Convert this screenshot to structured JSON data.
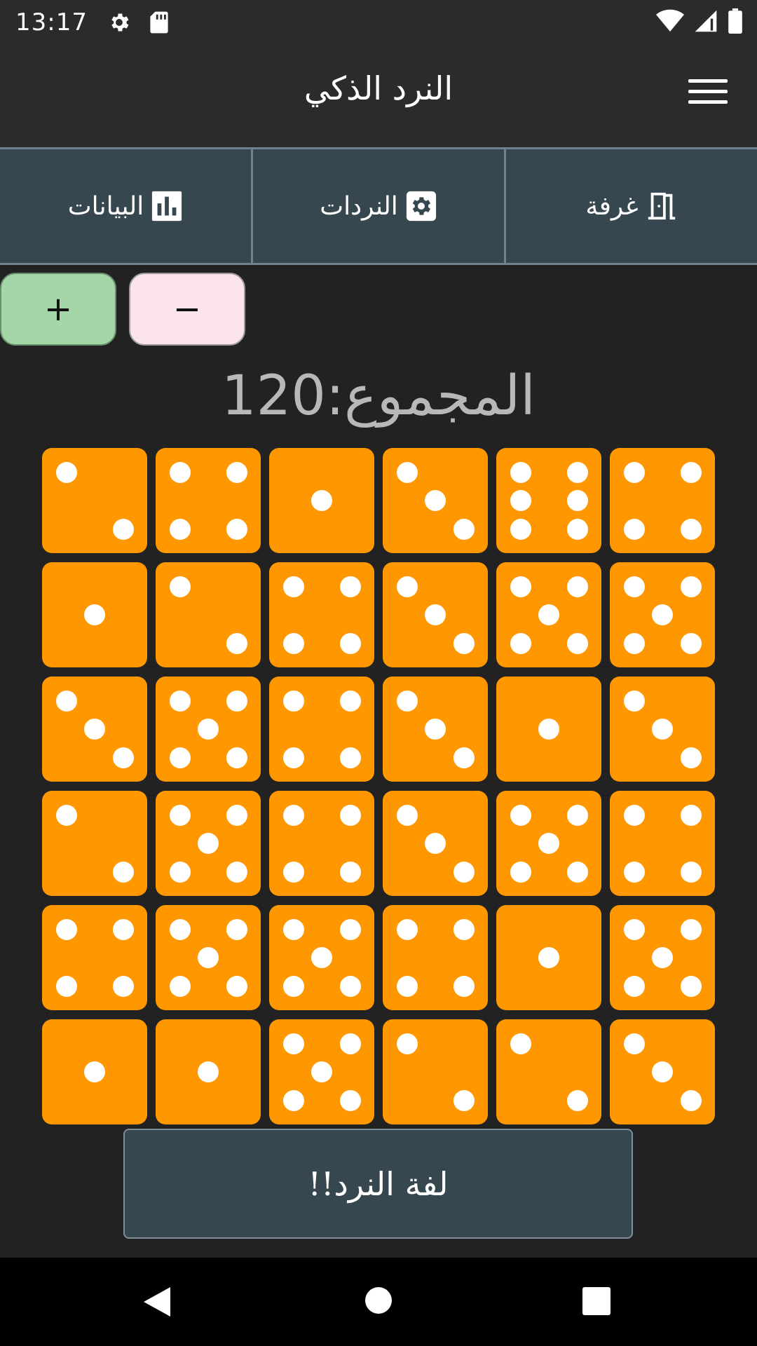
{
  "status_bar": {
    "time": "13:17",
    "left_icons": [
      "gear-icon",
      "sd-card-icon"
    ],
    "right_icons": [
      "wifi-icon",
      "signal-icon",
      "battery-icon"
    ]
  },
  "app_bar": {
    "title": "النرد الذكي",
    "menu_icon": "hamburger-menu-icon"
  },
  "tabs": [
    {
      "label": "البيانات",
      "icon": "bar-chart-icon"
    },
    {
      "label": "النردات",
      "icon": "settings-square-icon"
    },
    {
      "label": "غرفة",
      "icon": "door-icon"
    }
  ],
  "controls": {
    "plus_label": "+",
    "minus_label": "−"
  },
  "total": {
    "text": "المجموع:120"
  },
  "dice": [
    [
      2,
      4,
      1,
      3,
      6,
      4
    ],
    [
      1,
      2,
      4,
      3,
      5,
      5
    ],
    [
      3,
      5,
      4,
      3,
      1,
      3
    ],
    [
      2,
      5,
      4,
      3,
      5,
      4
    ],
    [
      4,
      5,
      5,
      4,
      1,
      5
    ],
    [
      1,
      1,
      5,
      2,
      2,
      3
    ]
  ],
  "colors": {
    "die": "#ff9800",
    "pip": "#ffffff",
    "tab_bg": "#37474f",
    "plus_bg": "#a5d6a7",
    "minus_bg": "#fce4ec"
  },
  "roll_button": {
    "label": "لفة النرد!!"
  },
  "nav_bar": {
    "icons": [
      "back-icon",
      "home-icon",
      "recents-icon"
    ]
  }
}
